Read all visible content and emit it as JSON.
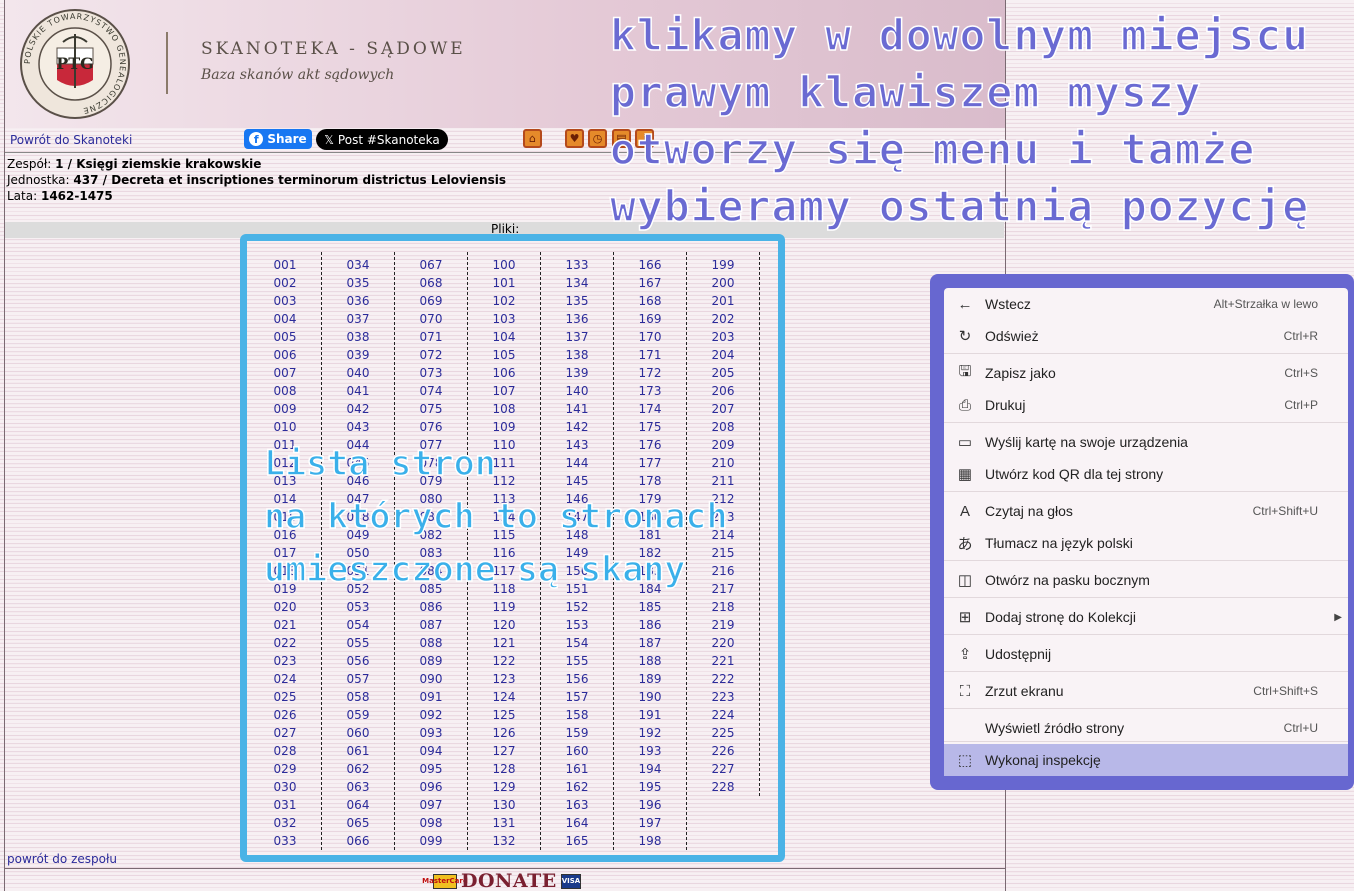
{
  "header": {
    "title": "SKANOTEKA - SĄDOWE",
    "subtitle": "Baza skanów akt sądowych",
    "logo_ring_text": "POLSKIE TOWARZYSTWO GENEALOGICZNE",
    "logo_mono": "PTG"
  },
  "nav": {
    "back_link": "Powrót do Skanoteki",
    "share_label": "Share",
    "post_label": "Post #Skanoteka",
    "icons": [
      "home-icon",
      "map-icon",
      "clock-icon",
      "print-icon",
      "info-icon"
    ]
  },
  "info": {
    "zespol_label": "Zespół:",
    "zespol_value": "1 / Księgi ziemskie krakowskie",
    "jednostka_label": "Jednostka:",
    "jednostka_value": "437 / Decreta et inscriptiones terminorum districtus Leloviensis",
    "lata_label": "Lata:",
    "lata_value": "1462-1475"
  },
  "files": {
    "label": "Pliki:",
    "columns": [
      [
        "001",
        "002",
        "003",
        "004",
        "005",
        "006",
        "007",
        "008",
        "009",
        "010",
        "011",
        "012",
        "013",
        "014",
        "015",
        "016",
        "017",
        "018",
        "019",
        "020",
        "021",
        "022",
        "023",
        "024",
        "025",
        "026",
        "027",
        "028",
        "029",
        "030",
        "031",
        "032",
        "033"
      ],
      [
        "034",
        "035",
        "036",
        "037",
        "038",
        "039",
        "040",
        "041",
        "042",
        "043",
        "044",
        "045",
        "046",
        "047",
        "048",
        "049",
        "050",
        "051",
        "052",
        "053",
        "054",
        "055",
        "056",
        "057",
        "058",
        "059",
        "060",
        "061",
        "062",
        "063",
        "064",
        "065",
        "066"
      ],
      [
        "067",
        "068",
        "069",
        "070",
        "071",
        "072",
        "073",
        "074",
        "075",
        "076",
        "077",
        "078",
        "079",
        "080",
        "081",
        "082",
        "083",
        "084",
        "085",
        "086",
        "087",
        "088",
        "089",
        "090",
        "091",
        "092",
        "093",
        "094",
        "095",
        "096",
        "097",
        "098",
        "099"
      ],
      [
        "100",
        "101",
        "102",
        "103",
        "104",
        "105",
        "106",
        "107",
        "108",
        "109",
        "110",
        "111",
        "112",
        "113",
        "114",
        "115",
        "116",
        "117",
        "118",
        "119",
        "120",
        "121",
        "122",
        "123",
        "124",
        "125",
        "126",
        "127",
        "128",
        "129",
        "130",
        "131",
        "132"
      ],
      [
        "133",
        "134",
        "135",
        "136",
        "137",
        "138",
        "139",
        "140",
        "141",
        "142",
        "143",
        "144",
        "145",
        "146",
        "147",
        "148",
        "149",
        "150",
        "151",
        "152",
        "153",
        "154",
        "155",
        "156",
        "157",
        "158",
        "159",
        "160",
        "161",
        "162",
        "163",
        "164",
        "165"
      ],
      [
        "166",
        "167",
        "168",
        "169",
        "170",
        "171",
        "172",
        "173",
        "174",
        "175",
        "176",
        "177",
        "178",
        "179",
        "180",
        "181",
        "182",
        "183",
        "184",
        "185",
        "186",
        "187",
        "188",
        "189",
        "190",
        "191",
        "192",
        "193",
        "194",
        "195",
        "196",
        "197",
        "198"
      ],
      [
        "199",
        "200",
        "201",
        "202",
        "203",
        "204",
        "205",
        "206",
        "207",
        "208",
        "209",
        "210",
        "211",
        "212",
        "213",
        "214",
        "215",
        "216",
        "217",
        "218",
        "219",
        "220",
        "221",
        "222",
        "223",
        "224",
        "225",
        "226",
        "227",
        "228"
      ]
    ]
  },
  "footer": {
    "back_team": "powrót do zespołu",
    "donate": "DONATE",
    "card1": "MasterCard",
    "card2": "VISA"
  },
  "annotations": {
    "top": "klikamy w dowolnym miejscu\nprawym klawiszem myszy\notworzy się menu i tamże\nwybieramy ostatnią pozycję",
    "list": "Lista stron\nna których to stronach\numieszczone są skany"
  },
  "context_menu": {
    "items": [
      {
        "icon": "back-arrow-icon",
        "glyph": "←",
        "label": "Wstecz",
        "shortcut": "Alt+Strzałka w lewo"
      },
      {
        "icon": "refresh-icon",
        "glyph": "↻",
        "label": "Odśwież",
        "shortcut": "Ctrl+R"
      },
      {
        "icon": "save-as-icon",
        "glyph": "🖫",
        "label": "Zapisz jako",
        "shortcut": "Ctrl+S"
      },
      {
        "icon": "print-icon",
        "glyph": "⎙",
        "label": "Drukuj",
        "shortcut": "Ctrl+P"
      },
      {
        "icon": "send-tab-icon",
        "glyph": "▭",
        "label": "Wyślij kartę na swoje urządzenia",
        "shortcut": ""
      },
      {
        "icon": "qr-code-icon",
        "glyph": "▦",
        "label": "Utwórz kod QR dla tej strony",
        "shortcut": ""
      },
      {
        "icon": "read-aloud-icon",
        "glyph": "A",
        "label": "Czytaj na głos",
        "shortcut": "Ctrl+Shift+U"
      },
      {
        "icon": "translate-icon",
        "glyph": "あ",
        "label": "Tłumacz na język polski",
        "shortcut": ""
      },
      {
        "icon": "sidebar-icon",
        "glyph": "◫",
        "label": "Otwórz na pasku bocznym",
        "shortcut": ""
      },
      {
        "icon": "collections-icon",
        "glyph": "⊞",
        "label": "Dodaj stronę do Kolekcji",
        "shortcut": ""
      },
      {
        "icon": "share-icon",
        "glyph": "⇪",
        "label": "Udostępnij",
        "shortcut": ""
      },
      {
        "icon": "screenshot-icon",
        "glyph": "⛶",
        "label": "Zrzut ekranu",
        "shortcut": "Ctrl+Shift+S"
      },
      {
        "icon": "",
        "glyph": "",
        "label": "Wyświetl źródło strony",
        "shortcut": "Ctrl+U"
      },
      {
        "icon": "inspect-icon",
        "glyph": "⬚",
        "label": "Wykonaj inspekcję",
        "shortcut": ""
      }
    ]
  }
}
